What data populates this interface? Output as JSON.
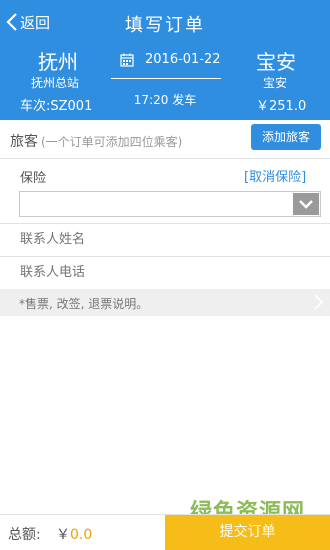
{
  "header": {
    "back_label": "返回",
    "title": "填写订单",
    "from_city": "抚州",
    "from_station": "抚州总站",
    "to_city": "宝安",
    "to_station": "宝安",
    "train_no": "车次:SZ001",
    "price": "￥251.0",
    "date": "2016-01-22",
    "depart": "17:20 发车"
  },
  "passenger": {
    "label": "旅客",
    "hint": "(一个订单可添加四位乘客)",
    "add_button": "添加旅客"
  },
  "insurance": {
    "label": "保险",
    "cancel": "[取消保险]",
    "selected": ""
  },
  "contact": {
    "name_placeholder": "联系人姓名",
    "phone_placeholder": "联系人电话"
  },
  "notes": {
    "text": "*售票, 改签, 退票说明。"
  },
  "footer": {
    "total_label": "总额:",
    "currency": "￥",
    "total_amount": "0.0",
    "submit": "提交订单"
  },
  "watermark": "绿色资源网",
  "colors": {
    "primary": "#2f8ee0",
    "submit": "#f6bc18",
    "amount": "#f0a000"
  }
}
